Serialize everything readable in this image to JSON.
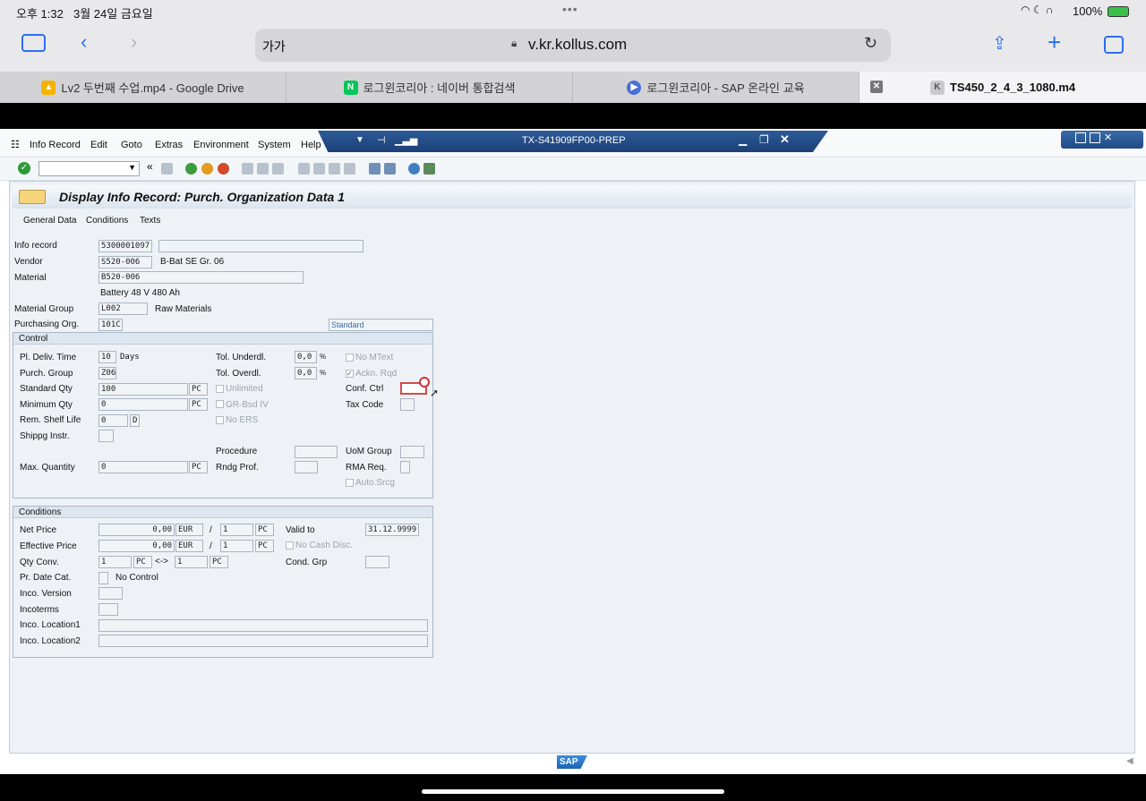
{
  "status": {
    "time": "오후 1:32",
    "date": "3월 24일 금요일",
    "battery": "100%"
  },
  "safari": {
    "text_size": "가가",
    "url": "v.kr.kollus.com"
  },
  "tabs": [
    {
      "label": "Lv2 두번째 수업.mp4 - Google Drive"
    },
    {
      "label": "로그윈코리아 : 네이버 통합검색"
    },
    {
      "label": "로그윈코리아 - SAP 온라인 교육"
    },
    {
      "label": "TS450_2_4_3_1080.m4"
    }
  ],
  "sap": {
    "menu": [
      "Info Record",
      "Edit",
      "Goto",
      "Extras",
      "Environment",
      "System",
      "Help"
    ],
    "window_title": "TX-S41909FP00-PREP",
    "page_title": "Display Info Record: Purch. Organization Data 1",
    "subtabs": [
      "General Data",
      "Conditions",
      "Texts"
    ],
    "header": {
      "info_record_label": "Info record",
      "info_record": "5300001097",
      "vendor_label": "Vendor",
      "vendor": "S520-006",
      "vendor_name": "B-Bat SE Gr. 06",
      "material_label": "Material",
      "material": "B520-006",
      "material_desc": "Battery 48 V 480 Ah",
      "matgroup_label": "Material Group",
      "matgroup": "L002",
      "matgroup_desc": "Raw Materials",
      "porg_label": "Purchasing Org.",
      "porg": "101C",
      "standard": "Standard"
    },
    "control": {
      "title": "Control",
      "pl_deliv_label": "Pl. Deliv. Time",
      "pl_deliv": "10",
      "days": "Days",
      "purch_group_label": "Purch. Group",
      "purch_group": "Z06",
      "std_qty_label": "Standard Qty",
      "std_qty": "100",
      "uom": "PC",
      "min_qty_label": "Minimum Qty",
      "min_qty": "0",
      "shelf_label": "Rem. Shelf Life",
      "shelf": "0",
      "shelf_unit": "D",
      "shipping_label": "Shippg Instr.",
      "max_qty_label": "Max. Quantity",
      "max_qty": "0",
      "tol_under_label": "Tol. Underdl.",
      "tol_under": "0,0",
      "pct": "%",
      "tol_over_label": "Tol. Overdl.",
      "tol_over": "0,0",
      "unlimited": "Unlimited",
      "gr_bsd": "GR-Bsd IV",
      "no_ers": "No ERS",
      "procedure_label": "Procedure",
      "rndg_label": "Rndg Prof.",
      "no_mtext": "No MText",
      "ackn_reqd": "Ackn. Rqd",
      "conf_ctrl_label": "Conf. Ctrl",
      "tax_code_label": "Tax Code",
      "uom_group_label": "UoM Group",
      "rma_label": "RMA Req.",
      "auto_srcg": "Auto.Srcg"
    },
    "conditions": {
      "title": "Conditions",
      "net_price_label": "Net Price",
      "net_price": "0,00",
      "currency": "EUR",
      "per": "1",
      "unit": "PC",
      "eff_price_label": "Effective Price",
      "eff_price": "0,00",
      "valid_to_label": "Valid to",
      "valid_to": "31.12.9999",
      "no_cash_disc": "No Cash Disc.",
      "qty_conv_label": "Qty Conv.",
      "conv_a": "1",
      "arrow": "<->",
      "conv_b": "1",
      "cond_grp_label": "Cond. Grp",
      "pr_date_label": "Pr. Date Cat.",
      "pr_date_desc": "No Control",
      "inco_version_label": "Inco. Version",
      "incoterms_label": "Incoterms",
      "inco_loc1_label": "Inco. Location1",
      "inco_loc2_label": "Inco. Location2"
    },
    "footer_logo": "SAP"
  }
}
